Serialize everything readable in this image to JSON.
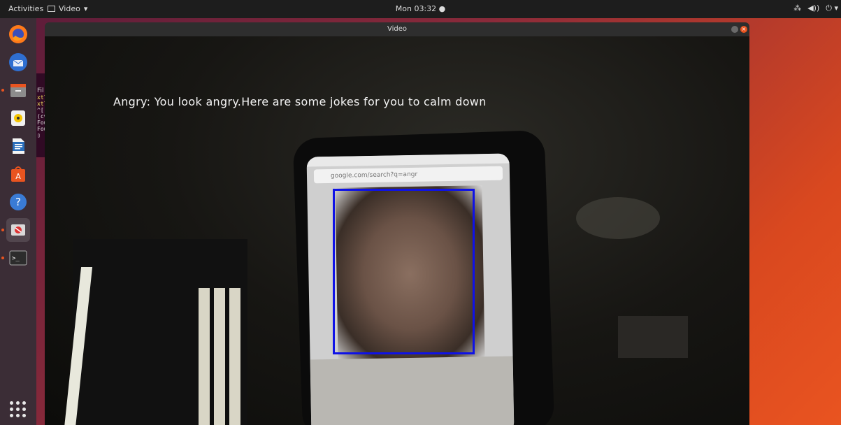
{
  "topbar": {
    "activities": "Activities",
    "app_menu": "Video",
    "clock": "Mon 03:32 ●",
    "tray": [
      "network-icon",
      "volume-icon",
      "power-icon"
    ]
  },
  "dock": {
    "items": [
      "firefox",
      "thunderbird",
      "files",
      "rhythmbox",
      "libreoffice-writer",
      "ubuntu-software",
      "help",
      "video-app",
      "terminal"
    ],
    "apps_grid": "show-applications"
  },
  "terminal": {
    "menu_label": "Fil",
    "lines": [
      "xtl",
      "xtl",
      "^[[",
      "(cv",
      "Fou",
      "Fou",
      "▯"
    ]
  },
  "window": {
    "title": "Video",
    "close_glyph": "×"
  },
  "video": {
    "caption": "Angry: You look angry.Here are some jokes for you to calm down",
    "phone_url": "google.com/search?q=angr",
    "box_color": "#0f12e6"
  },
  "colors": {
    "accent": "#e95420",
    "topbar": "#1d1d1d",
    "dock": "#3b2d36"
  }
}
